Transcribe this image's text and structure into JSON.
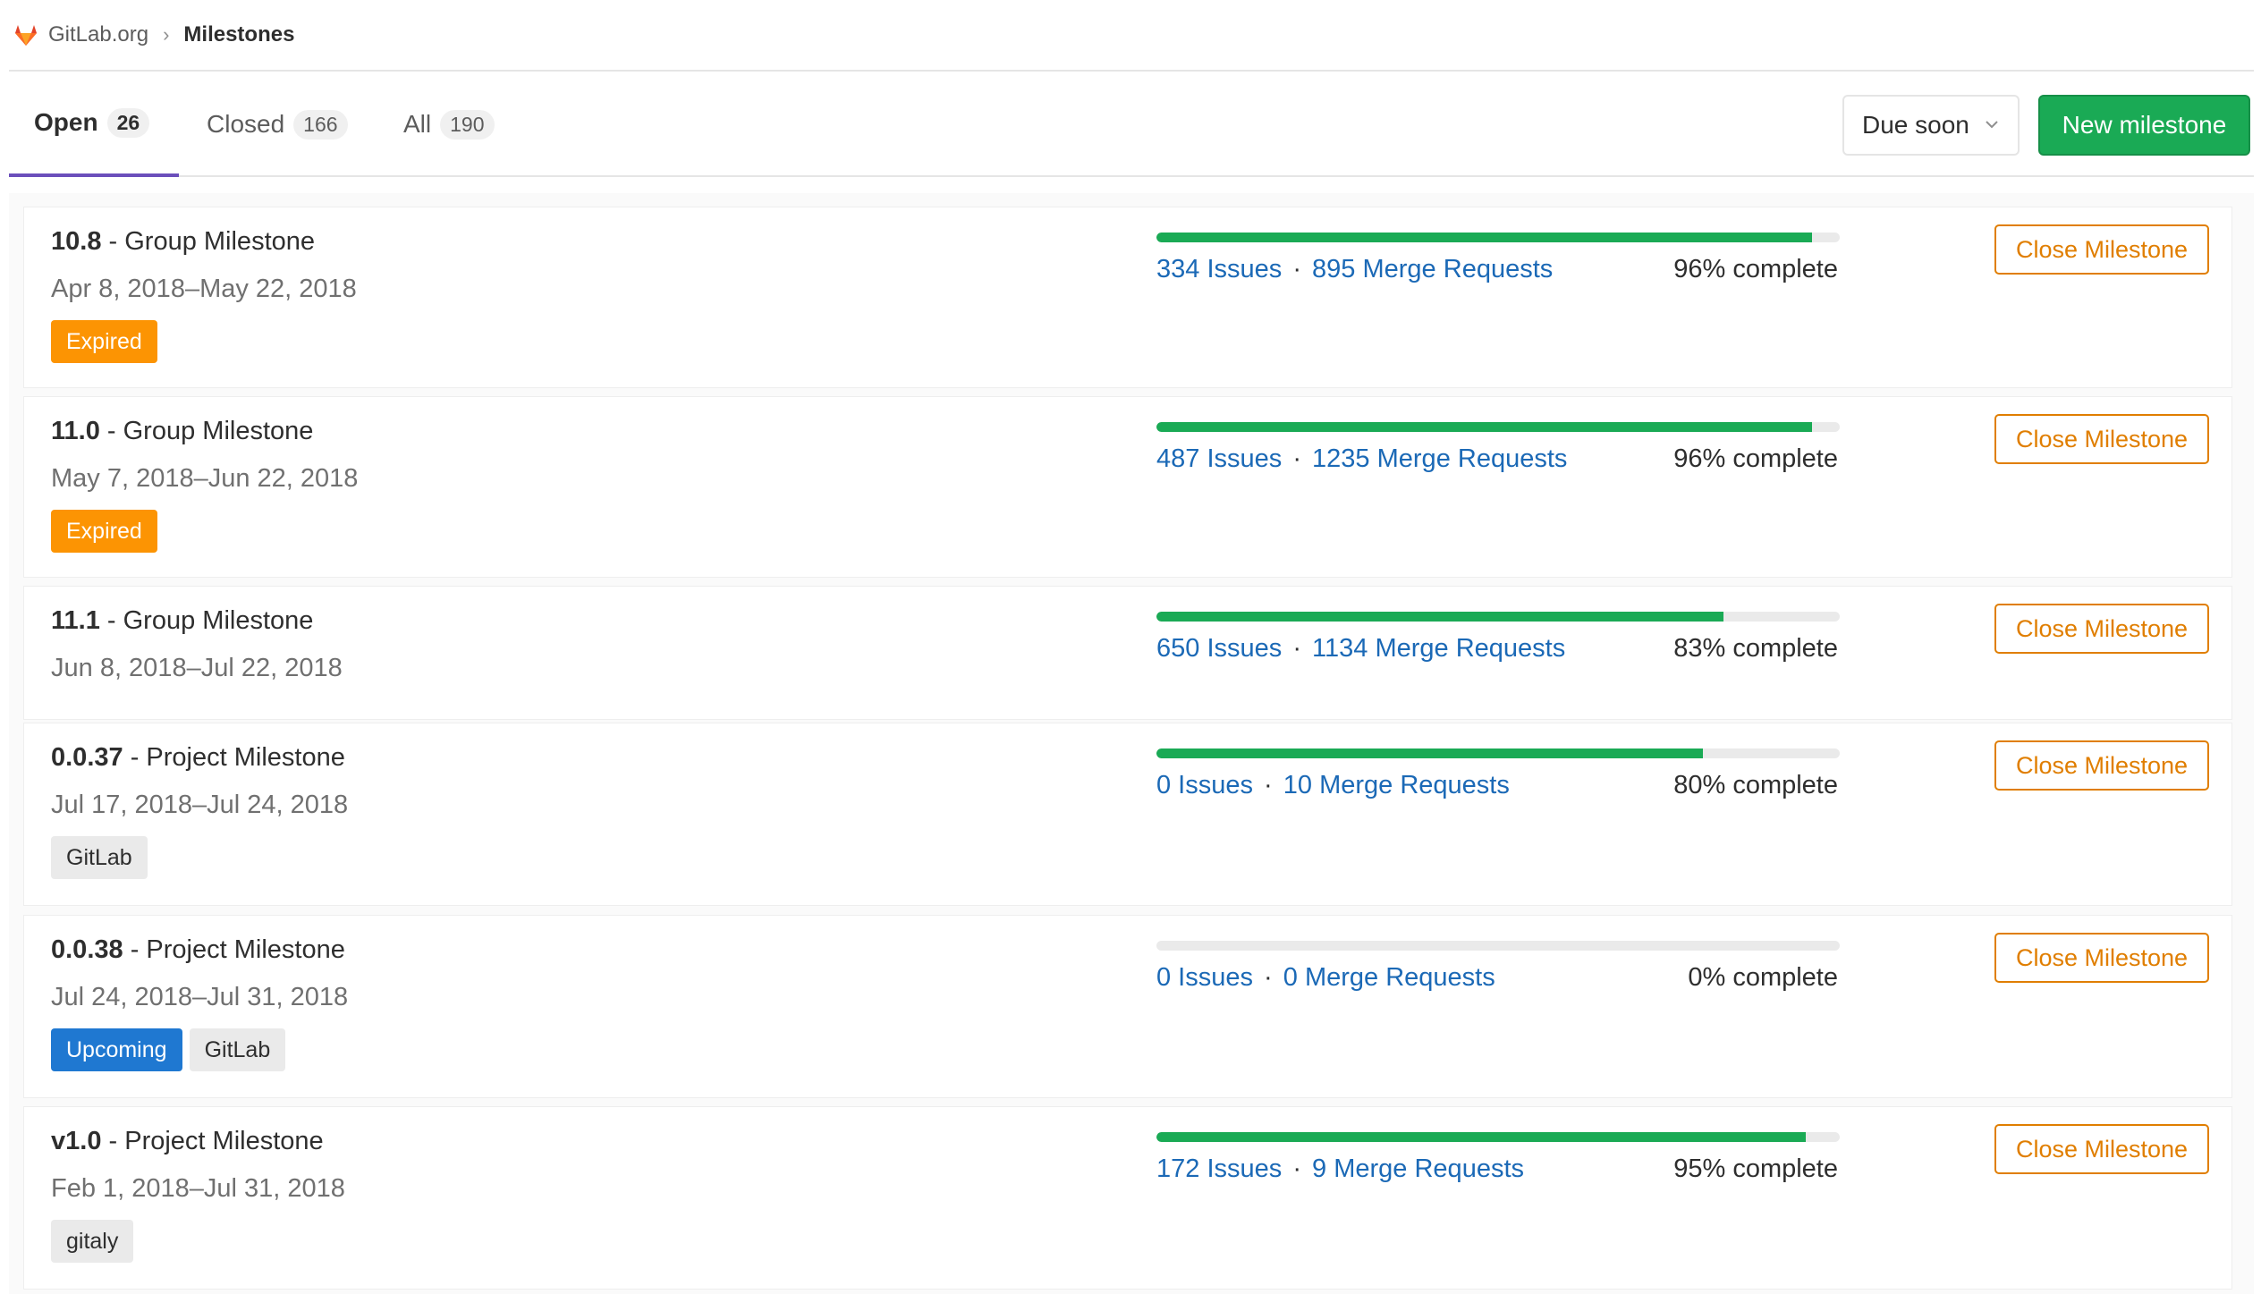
{
  "breadcrumb": {
    "group": "GitLab.org",
    "current": "Milestones"
  },
  "tabs": [
    {
      "label": "Open",
      "count": "26"
    },
    {
      "label": "Closed",
      "count": "166"
    },
    {
      "label": "All",
      "count": "190"
    }
  ],
  "sort": {
    "label": "Due soon"
  },
  "new_milestone_label": "New milestone",
  "close_label": "Close Milestone",
  "colors": {
    "progress": "#1aaa55",
    "expired": "#fc9403",
    "upcoming": "#1f78d1",
    "link": "#1b69b6",
    "tab_active": "#6b4fbb",
    "new_button": "#1aaa55",
    "close_button": "#e07e00"
  },
  "milestones": [
    {
      "version": "10.8",
      "type": "Group Milestone",
      "dates": "Apr 8, 2018–May 22, 2018",
      "labels": [
        "Expired"
      ],
      "issues": "334 Issues",
      "merge_requests": "895 Merge Requests",
      "complete": "96% complete",
      "progress": 0.96
    },
    {
      "version": "11.0",
      "type": "Group Milestone",
      "dates": "May 7, 2018–Jun 22, 2018",
      "labels": [
        "Expired"
      ],
      "issues": "487 Issues",
      "merge_requests": "1235 Merge Requests",
      "complete": "96% complete",
      "progress": 0.96
    },
    {
      "version": "11.1",
      "type": "Group Milestone",
      "dates": "Jun 8, 2018–Jul 22, 2018",
      "labels": [],
      "issues": "650 Issues",
      "merge_requests": "1134 Merge Requests",
      "complete": "83% complete",
      "progress": 0.83
    },
    {
      "version": "0.0.37",
      "type": "Project Milestone",
      "dates": "Jul 17, 2018–Jul 24, 2018",
      "labels": [
        "GitLab"
      ],
      "issues": "0 Issues",
      "merge_requests": "10 Merge Requests",
      "complete": "80% complete",
      "progress": 0.8
    },
    {
      "version": "0.0.38",
      "type": "Project Milestone",
      "dates": "Jul 24, 2018–Jul 31, 2018",
      "labels": [
        "Upcoming",
        "GitLab"
      ],
      "issues": "0 Issues",
      "merge_requests": "0 Merge Requests",
      "complete": "0% complete",
      "progress": 0.0
    },
    {
      "version": "v1.0",
      "type": "Project Milestone",
      "dates": "Feb 1, 2018–Jul 31, 2018",
      "labels": [
        "gitaly"
      ],
      "issues": "172 Issues",
      "merge_requests": "9 Merge Requests",
      "complete": "95% complete",
      "progress": 0.95
    }
  ]
}
